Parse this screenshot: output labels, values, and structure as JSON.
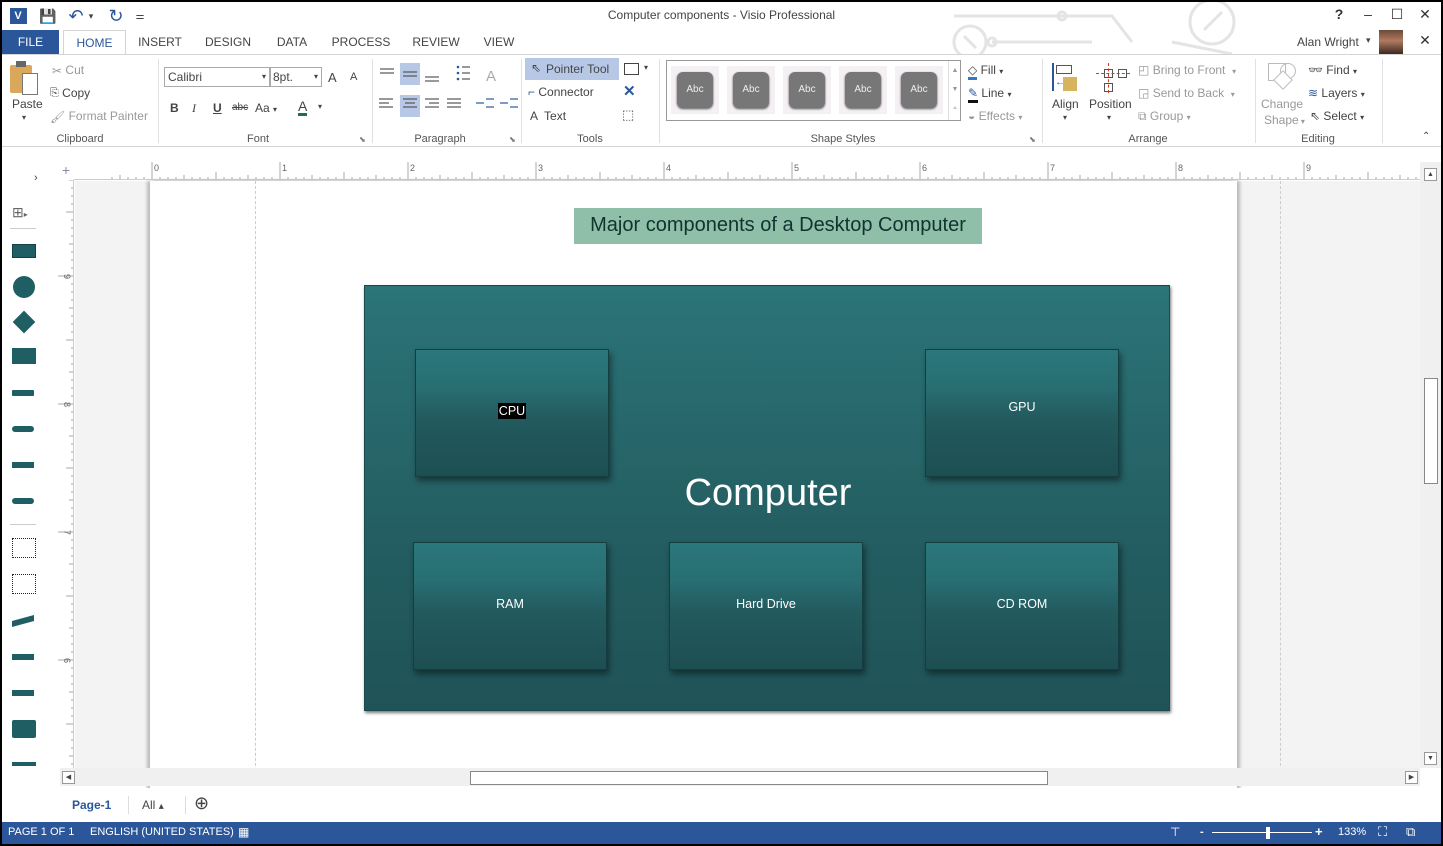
{
  "window": {
    "title": "Computer components - Visio Professional",
    "help": "?",
    "minimize": "–",
    "maximize": "☐",
    "close": "✕",
    "ribbon_close": "✕"
  },
  "qat": {
    "app_icon": "V",
    "save": "💾",
    "undo": "↶",
    "undo_dd": "▾",
    "redo": "↻",
    "customize": "⚌"
  },
  "account": {
    "name": "Alan Wright",
    "dropdown": "▾"
  },
  "tabs": [
    "FILE",
    "HOME",
    "INSERT",
    "DESIGN",
    "DATA",
    "PROCESS",
    "REVIEW",
    "VIEW"
  ],
  "ribbon": {
    "clipboard": {
      "label": "Clipboard",
      "paste": "Paste",
      "cut": "Cut",
      "copy": "Copy",
      "format_painter": "Format Painter"
    },
    "font": {
      "label": "Font",
      "family": "Calibri",
      "size": "8pt.",
      "grow": "A",
      "shrink": "A",
      "bold": "B",
      "italic": "I",
      "underline": "U",
      "strike": "abc",
      "case": "Aa",
      "color": "A"
    },
    "paragraph": {
      "label": "Paragraph"
    },
    "tools": {
      "label": "Tools",
      "pointer": "Pointer Tool",
      "connector": "Connector",
      "text": "Text"
    },
    "shape_styles": {
      "label": "Shape Styles",
      "styles": [
        "Abc",
        "Abc",
        "Abc",
        "Abc",
        "Abc"
      ],
      "fill": "Fill",
      "line": "Line",
      "effects": "Effects"
    },
    "arrange": {
      "label": "Arrange",
      "align": "Align",
      "position": "Position",
      "bring_front": "Bring to Front",
      "send_back": "Send to Back",
      "group": "Group"
    },
    "editing": {
      "label": "Editing",
      "change_shape_1": "Change",
      "change_shape_2": "Shape",
      "find": "Find",
      "layers": "Layers",
      "select": "Select"
    }
  },
  "ruler": {
    "h_ticks": [
      "0",
      "1",
      "2",
      "3",
      "4",
      "5",
      "6",
      "7",
      "8",
      "9"
    ],
    "v_ticks": [
      "9",
      "8",
      "7",
      "6"
    ]
  },
  "diagram": {
    "title": "Major components of a Desktop Computer",
    "container": "Computer",
    "components": [
      "CPU",
      "GPU",
      "RAM",
      "Hard Drive",
      "CD ROM"
    ],
    "selected": "CPU"
  },
  "pages": {
    "current": "Page-1",
    "all": "All",
    "all_arrow": "▴",
    "add": "⊕"
  },
  "status": {
    "page": "PAGE 1 OF 1",
    "language": "ENGLISH (UNITED STATES)",
    "zoom": "133%",
    "zoom_minus": "-",
    "zoom_plus": "+",
    "zoom_level_percent": 133
  },
  "colors": {
    "accent": "#2b579a",
    "container": "#245f63",
    "title_fill": "#8fbfa8"
  }
}
